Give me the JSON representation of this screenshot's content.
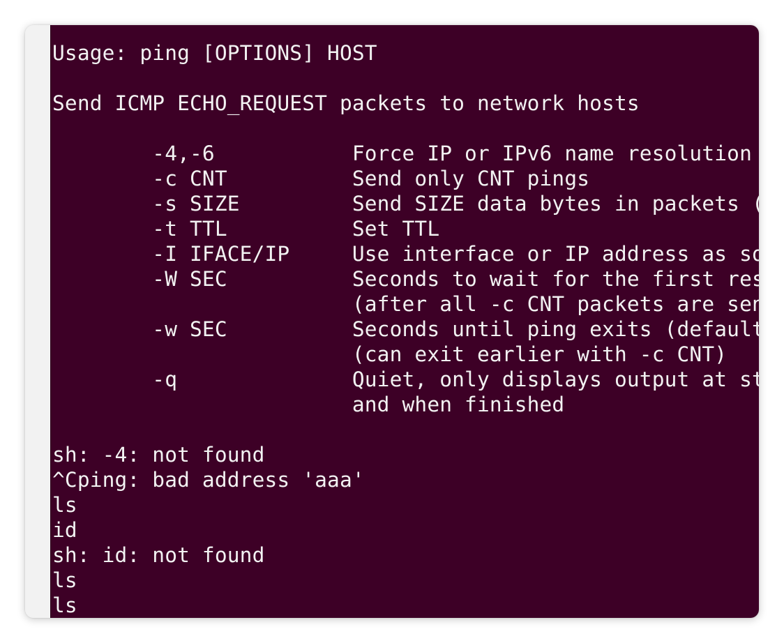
{
  "terminal": {
    "lines": [
      "Usage: ping [OPTIONS] HOST",
      "",
      "Send ICMP ECHO_REQUEST packets to network hosts",
      "",
      "        -4,-6           Force IP or IPv6 name resolution",
      "        -c CNT          Send only CNT pings",
      "        -s SIZE         Send SIZE data bytes in packets (",
      "        -t TTL          Set TTL",
      "        -I IFACE/IP     Use interface or IP address as so",
      "        -W SEC          Seconds to wait for the first res",
      "                        (after all -c CNT packets are sen",
      "        -w SEC          Seconds until ping exits (default",
      "                        (can exit earlier with -c CNT)",
      "        -q              Quiet, only displays output at st",
      "                        and when finished",
      "",
      "sh: -4: not found",
      "^Cping: bad address 'aaa'",
      "ls",
      "id",
      "sh: id: not found",
      "ls",
      "ls"
    ]
  },
  "colors": {
    "terminal_background": "#3d0026",
    "terminal_foreground": "#f2f2f2"
  }
}
